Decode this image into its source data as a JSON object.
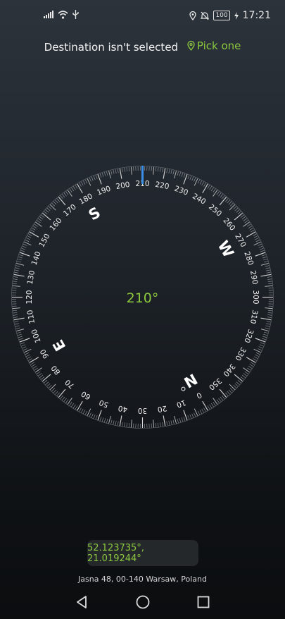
{
  "status_bar": {
    "time": "17:21",
    "battery": "100",
    "icons": [
      "signal-icon",
      "wifi-icon",
      "usb-icon",
      "location-icon",
      "alarm-off-icon",
      "battery-icon",
      "charging-icon"
    ]
  },
  "header": {
    "label": "Destination isn't selected",
    "pick_label": "Pick one",
    "accent": "#8cc83e"
  },
  "compass": {
    "heading_text": "210°",
    "heading": 210,
    "cardinals": [
      "N",
      "E",
      "S",
      "W"
    ],
    "ring_labels": [
      "0",
      "10",
      "20",
      "30",
      "40",
      "50",
      "60",
      "70",
      "80",
      "90",
      "100",
      "110",
      "120",
      "130",
      "140",
      "150",
      "160",
      "170",
      "180",
      "190",
      "200",
      "210",
      "220",
      "230",
      "240",
      "250",
      "260",
      "270",
      "280",
      "290",
      "300",
      "310",
      "320",
      "330",
      "340",
      "350"
    ],
    "indicator_color": "#3a8ee6"
  },
  "location": {
    "coords": "52.123735°, 21.019244°",
    "address": "Jasna 48, 00-140 Warsaw, Poland"
  },
  "nav": {
    "icons": [
      "back-icon",
      "home-icon",
      "recents-icon"
    ]
  }
}
